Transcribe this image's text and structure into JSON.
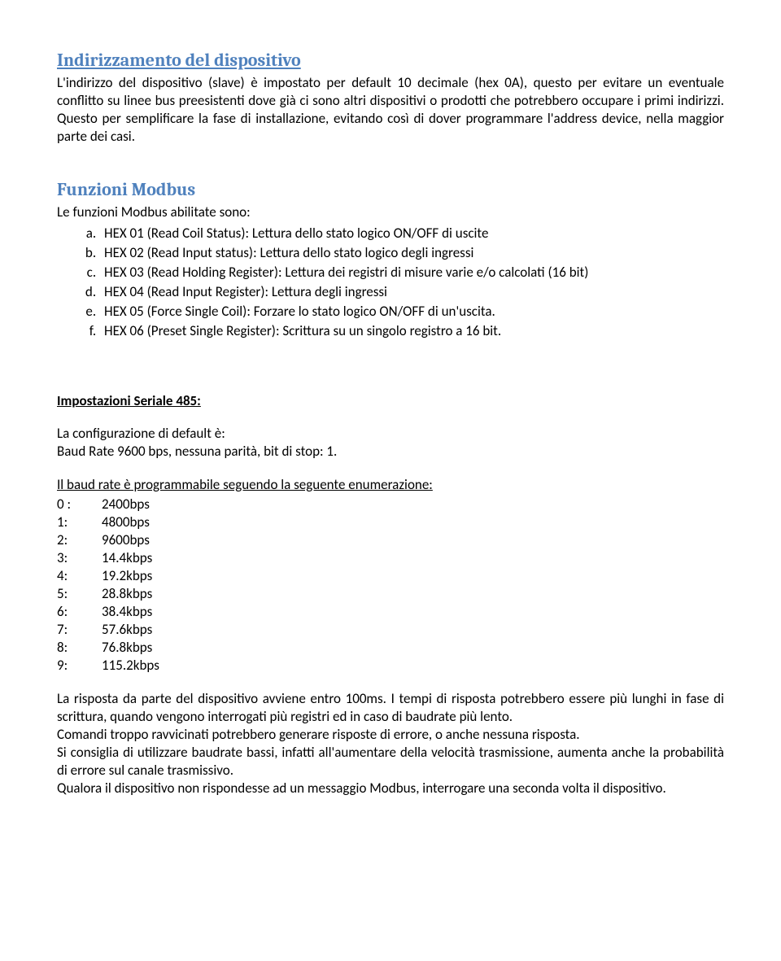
{
  "section1": {
    "title": "Indirizzamento del dispositivo",
    "para1": "L'indirizzo del dispositivo (slave) è impostato per default  10 decimale (hex 0A),  questo per evitare un eventuale conflitto su linee bus preesistenti dove già ci sono altri dispositivi o prodotti che potrebbero occupare i primi indirizzi. Questo per semplificare la fase di installazione, evitando così di dover programmare l'address device, nella maggior parte dei casi."
  },
  "section2": {
    "title": "Funzioni Modbus",
    "intro": "Le funzioni Modbus abilitate sono:",
    "items": [
      "HEX 01 (Read Coil Status): Lettura dello stato logico ON/OFF di uscite",
      "HEX 02 (Read Input status): Lettura dello stato logico degli ingressi",
      "HEX 03 (Read Holding Register): Lettura dei registri di misure varie e/o calcolati (16 bit)",
      "HEX 04 (Read Input Register): Lettura degli ingressi",
      "HEX 05 (Force Single Coil): Forzare lo stato logico ON/OFF di un'uscita.",
      "HEX 06 (Preset Single Register): Scrittura su un singolo registro a 16 bit."
    ]
  },
  "section3": {
    "title": "Impostazioni Seriale 485:",
    "para1a": "La configurazione di default è:",
    "para1b": "Baud Rate 9600 bps, nessuna parità, bit di stop: 1.",
    "para2": "Il baud rate è programmabile seguendo la seguente enumerazione:",
    "baud": [
      {
        "k": "0 :",
        "v": "2400bps"
      },
      {
        "k": "1:",
        "v": "4800bps"
      },
      {
        "k": "2:",
        "v": "9600bps"
      },
      {
        "k": "3:",
        "v": "14.4kbps"
      },
      {
        "k": "4:",
        "v": "19.2kbps"
      },
      {
        "k": "5:",
        "v": "28.8kbps"
      },
      {
        "k": "6:",
        "v": "38.4kbps"
      },
      {
        "k": "7:",
        "v": "57.6kbps"
      },
      {
        "k": "8:",
        "v": "76.8kbps"
      },
      {
        "k": "9:",
        "v": "115.2kbps"
      }
    ],
    "para3": "La risposta da parte del dispositivo avviene entro 100ms. I tempi di risposta potrebbero essere più lunghi in fase di scrittura, quando vengono interrogati più registri ed in caso di baudrate più lento.",
    "para4": "Comandi troppo ravvicinati potrebbero generare risposte di errore, o anche nessuna risposta.",
    "para5": "Si consiglia di utilizzare baudrate bassi, infatti all'aumentare della velocità trasmissione, aumenta anche la probabilità di errore sul canale trasmissivo.",
    "para6": "Qualora il dispositivo non rispondesse ad un messaggio Modbus, interrogare una seconda volta il dispositivo."
  }
}
